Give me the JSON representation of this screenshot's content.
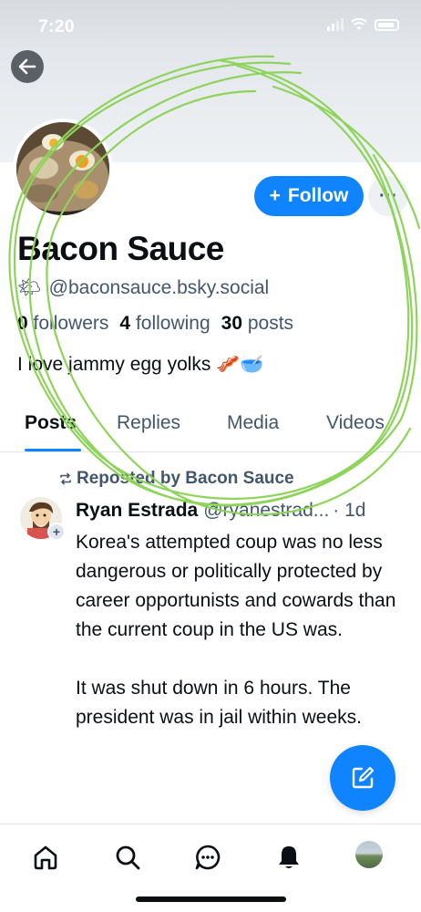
{
  "status_bar": {
    "time": "7:20"
  },
  "profile": {
    "display_name": "Bacon Sauce",
    "handle_emoji": "🌤",
    "handle": "@baconsauce.bsky.social",
    "followers_count": "0",
    "followers_label": "followers",
    "following_count": "4",
    "following_label": "following",
    "posts_count": "30",
    "posts_label": "posts",
    "bio": "I love jammy egg yolks 🥓🥣",
    "follow_label": "Follow",
    "follow_icon": "+",
    "more_icon": "···"
  },
  "tabs": [
    "Posts",
    "Replies",
    "Media",
    "Videos"
  ],
  "feed": {
    "repost_label": "Reposted by Bacon Sauce",
    "post": {
      "author": "Ryan Estrada",
      "handle": "@ryanestrad...",
      "time": "· 1d",
      "paragraphs": [
        "Korea's attempted coup was no less dangerous or politically protected by career opportunists and cowards than the current coup in the US was.",
        "It was shut down in 6 hours. The president was in jail within weeks."
      ]
    }
  },
  "colors": {
    "accent": "#1083fe",
    "muted": "#42576c",
    "scribble": "#8ed35a"
  },
  "icons": [
    "back-arrow-icon",
    "compose-icon",
    "home-icon",
    "search-icon",
    "chat-icon",
    "bell-icon",
    "repost-icon"
  ]
}
